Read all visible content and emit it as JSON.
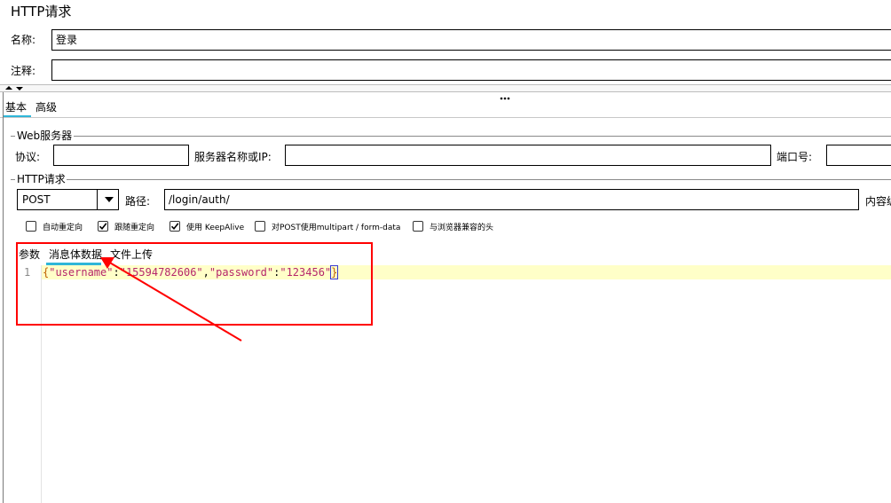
{
  "panel_title": "HTTP请求",
  "name_label": "名称:",
  "name_value": "登录",
  "comment_label": "注释:",
  "comment_value": "",
  "tabs": {
    "basic": "基本",
    "advanced": "高级"
  },
  "web_server": {
    "legend": "Web服务器",
    "protocol_label": "协议:",
    "protocol_value": "",
    "server_label": "服务器名称或IP:",
    "server_value": "",
    "port_label": "端口号:",
    "port_value": ""
  },
  "http_request": {
    "legend": "HTTP请求",
    "method": "POST",
    "path_label": "路径:",
    "path_value": "/login/auth/",
    "content_encoding_label": "内容编"
  },
  "options": [
    {
      "label": "自动重定向",
      "checked": false
    },
    {
      "label": "跟随重定向",
      "checked": true
    },
    {
      "label": "使用 KeepAlive",
      "checked": true
    },
    {
      "label": "对POST使用multipart / form-data",
      "checked": false
    },
    {
      "label": "与浏览器兼容的头",
      "checked": false
    }
  ],
  "sub_tabs": {
    "params": "参数",
    "body_data": "消息体数据",
    "file_upload": "文件上传"
  },
  "editor": {
    "line_number": "1",
    "tokens": [
      "{",
      "\"username\"",
      ":",
      "\"15594782606\"",
      ",",
      "\"password\"",
      ":",
      "\"123456\"",
      "}"
    ]
  },
  "colors": {
    "accent": "#2fb6d8",
    "highlight_line": "#ffffc8",
    "annotation": "#ff0000",
    "json_key": "#b5266b",
    "json_string": "#b5266b",
    "json_brace": "#c06000"
  },
  "icons": {
    "collapse_up": "triangle-up-icon",
    "collapse_down": "triangle-down-icon",
    "splitter_grip": "grip-dots-icon",
    "dropdown": "chevron-down-icon"
  }
}
